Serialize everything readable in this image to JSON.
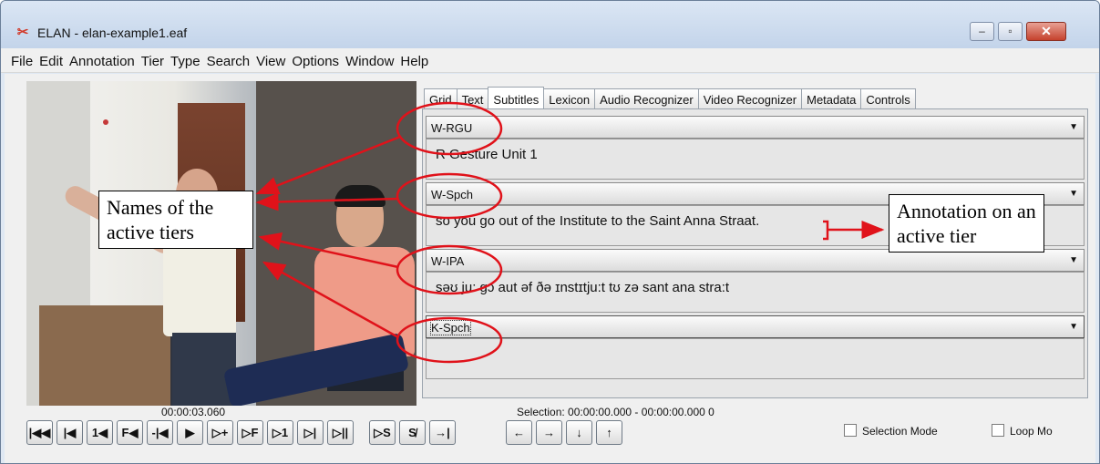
{
  "window": {
    "title": "ELAN - elan-example1.eaf",
    "app_icon_glyph": "✂",
    "min_glyph": "–",
    "max_glyph": "▫",
    "close_glyph": "✕"
  },
  "menu": [
    "File",
    "Edit",
    "Annotation",
    "Tier",
    "Type",
    "Search",
    "View",
    "Options",
    "Window",
    "Help"
  ],
  "tabs": [
    {
      "label": "Grid",
      "active": false
    },
    {
      "label": "Text",
      "active": false
    },
    {
      "label": "Subtitles",
      "active": true
    },
    {
      "label": "Lexicon",
      "active": false
    },
    {
      "label": "Audio Recognizer",
      "active": false
    },
    {
      "label": "Video Recognizer",
      "active": false
    },
    {
      "label": "Metadata",
      "active": false
    },
    {
      "label": "Controls",
      "active": false
    }
  ],
  "tiers": [
    {
      "name": "W-RGU",
      "annotation": "R Gesture Unit 1"
    },
    {
      "name": "W-Spch",
      "annotation": "so you go out of the Institute to the Saint Anna Straat."
    },
    {
      "name": "W-IPA",
      "annotation": "səʊ ju: gɔ aut əf ðə ɪnstɪtju:t tʊ zə sant ana stra:t"
    },
    {
      "name": "K-Spch",
      "annotation": ""
    }
  ],
  "status": {
    "timecode": "00:00:03.060",
    "selection": "Selection: 00:00:00.000 - 00:00:00.000  0"
  },
  "controls": {
    "media": [
      "|◀◀",
      "|◀",
      "1◀",
      "F◀",
      "-|◀",
      "▶",
      "▷+",
      "▷F",
      "▷1",
      "▷|",
      "▷||"
    ],
    "selection": [
      "▷S",
      "S̸",
      "→|"
    ],
    "arrows": [
      "←",
      "→",
      "↓",
      "↑"
    ],
    "selection_mode_label": "Selection Mode",
    "loop_mode_label": "Loop Mo"
  },
  "callouts": {
    "tier_names": "Names of the active tiers",
    "annotation": "Annotation on an active tier"
  },
  "colors": {
    "annotation_mark": "#e0121a"
  }
}
